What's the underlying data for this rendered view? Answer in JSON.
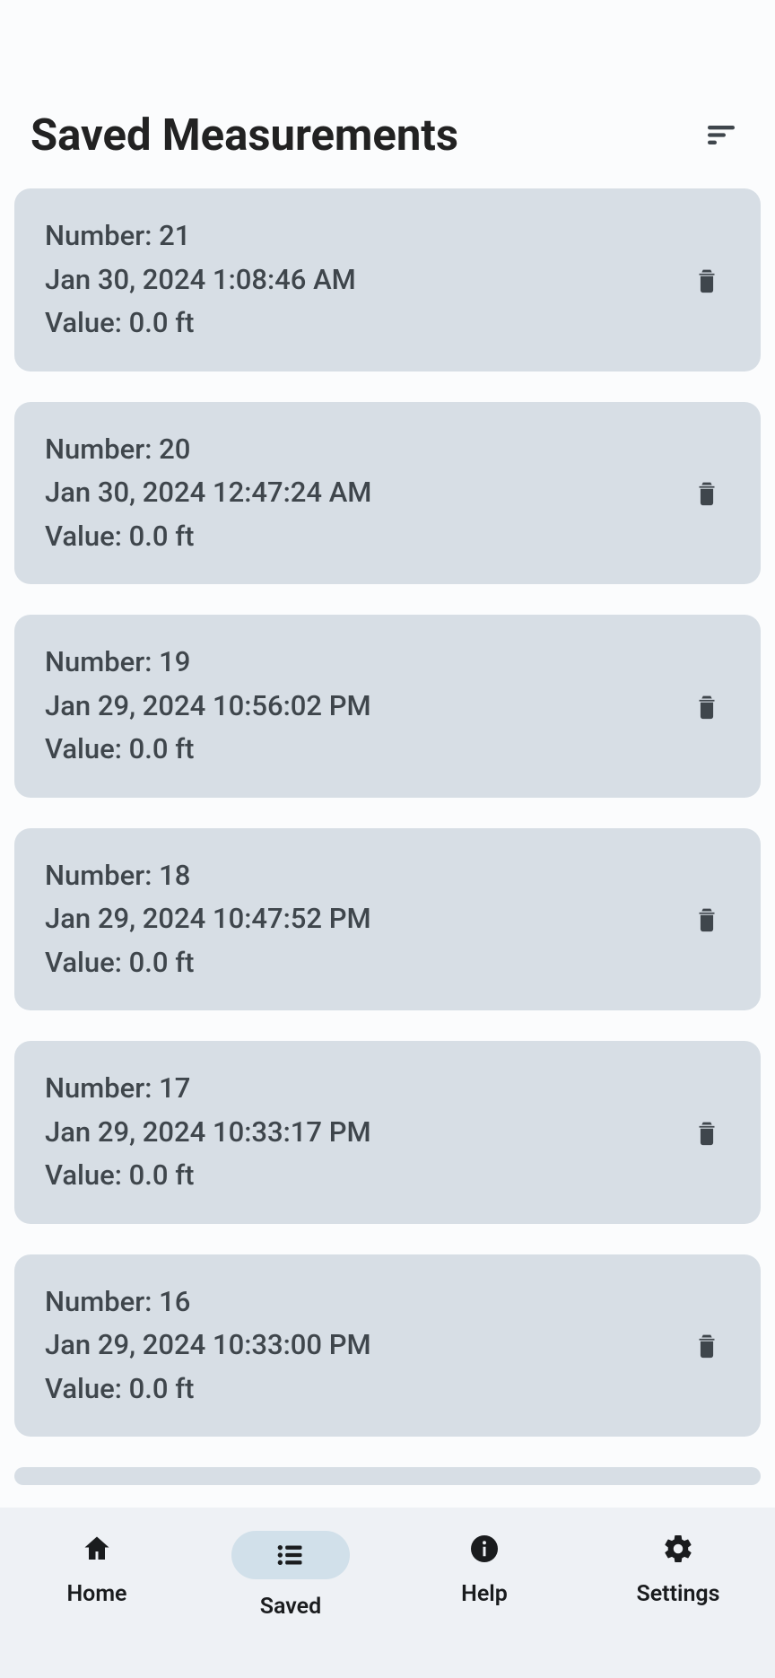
{
  "header": {
    "title": "Saved Measurements"
  },
  "icons": {
    "sort": "sort-icon",
    "delete": "trash-icon",
    "home": "home-icon",
    "saved": "list-icon",
    "help": "info-icon",
    "settings": "gear-icon"
  },
  "measurements": [
    {
      "number_line": "Number: 21",
      "time_line": "Jan 30, 2024 1:08:46 AM",
      "value_line": "Value: 0.0 ft"
    },
    {
      "number_line": "Number: 20",
      "time_line": "Jan 30, 2024 12:47:24 AM",
      "value_line": "Value: 0.0 ft"
    },
    {
      "number_line": "Number: 19",
      "time_line": "Jan 29, 2024 10:56:02 PM",
      "value_line": "Value: 0.0 ft"
    },
    {
      "number_line": "Number: 18",
      "time_line": "Jan 29, 2024 10:47:52 PM",
      "value_line": "Value: 0.0 ft"
    },
    {
      "number_line": "Number: 17",
      "time_line": "Jan 29, 2024 10:33:17 PM",
      "value_line": "Value: 0.0 ft"
    },
    {
      "number_line": "Number: 16",
      "time_line": "Jan 29, 2024 10:33:00 PM",
      "value_line": "Value: 0.0 ft"
    }
  ],
  "nav": {
    "home": {
      "label": "Home",
      "active": false
    },
    "saved": {
      "label": "Saved",
      "active": true
    },
    "help": {
      "label": "Help",
      "active": false
    },
    "settings": {
      "label": "Settings",
      "active": false
    }
  },
  "colors": {
    "card_bg": "#d7dee5",
    "text": "#3f464c",
    "nav_bg": "#eef1f5",
    "nav_active_bg": "#d1e0ea",
    "icon_dark": "#3f464c"
  }
}
